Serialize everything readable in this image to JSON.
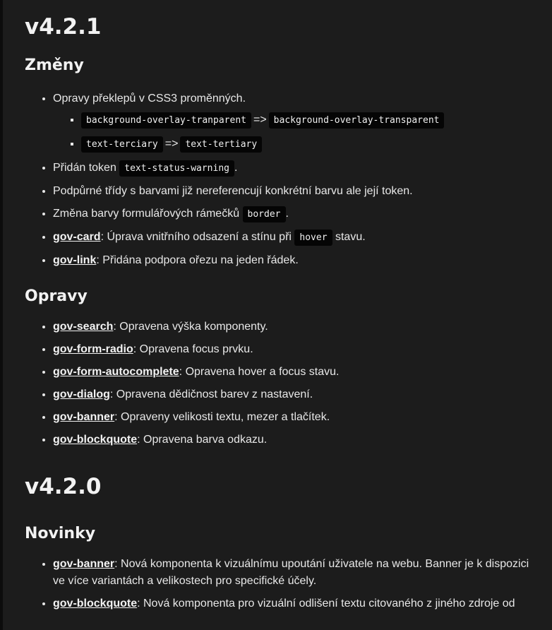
{
  "v421": {
    "title": "v4.2.1",
    "changes": {
      "title": "Změny",
      "item1": {
        "text": "Opravy překlepů v CSS3 proměnných.",
        "sub": [
          {
            "from": "background-overlay-tranparent",
            "arrow": "=>",
            "to": "background-overlay-transparent"
          },
          {
            "from": "text-terciary",
            "arrow": "=>",
            "to": "text-tertiary"
          }
        ]
      },
      "item2": {
        "pre": "Přidán token ",
        "code": "text-status-warning",
        "post": "."
      },
      "item3": {
        "text": "Podpůrné třídy s barvami již nereferencují konkrétní barvu ale její token."
      },
      "item4": {
        "pre": "Změna barvy formulářových rámečků ",
        "code": "border",
        "post": "."
      },
      "item5": {
        "link": "gov-card",
        "pre": ": Úprava vnitřního odsazení a stínu při ",
        "code": "hover",
        "post": " stavu."
      },
      "item6": {
        "link": "gov-link",
        "text": ": Přidána podpora ořezu na jeden řádek."
      }
    },
    "fixes": {
      "title": "Opravy",
      "items": [
        {
          "link": "gov-search",
          "text": ": Opravena výška komponenty."
        },
        {
          "link": "gov-form-radio",
          "text": ": Opravena focus prvku."
        },
        {
          "link": "gov-form-autocomplete",
          "text": ": Opravena hover a focus stavu."
        },
        {
          "link": "gov-dialog",
          "text": ": Opravena dědičnost barev z nastavení."
        },
        {
          "link": "gov-banner",
          "text": ": Opraveny velikosti textu, mezer a tlačítek."
        },
        {
          "link": "gov-blockquote",
          "text": ": Opravena barva odkazu."
        }
      ]
    }
  },
  "v420": {
    "title": "v4.2.0",
    "news": {
      "title": "Novinky",
      "items": [
        {
          "link": "gov-banner",
          "text": ": Nová komponenta k vizuálnímu upoutání uživatele na webu. Banner je k dispozici ve více variantách a velikostech pro specifické účely."
        },
        {
          "link": "gov-blockquote",
          "text": ": Nová komponenta pro vizuální odlišení textu citovaného z jiného zdroje od"
        }
      ]
    }
  }
}
